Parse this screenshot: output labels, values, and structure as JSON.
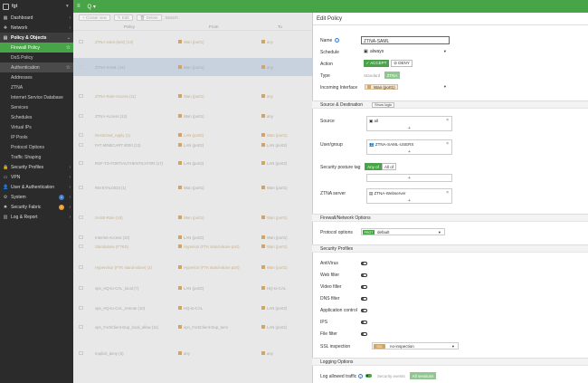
{
  "sidebar": {
    "device": "fgt",
    "items": [
      {
        "label": "Dashboard",
        "icon": "dashboard-icon",
        "glyph": "▦"
      },
      {
        "label": "Network",
        "icon": "network-icon",
        "glyph": "✚"
      },
      {
        "label": "Policy & Objects",
        "icon": "policy-icon",
        "glyph": "▤"
      }
    ],
    "sub": [
      "Firewall Policy",
      "DoS Policy",
      "Authentication",
      "Addresses",
      "ZTNA",
      "Internet Service Database",
      "Services",
      "Schedules",
      "Virtual IPs",
      "IP Pools",
      "Protocol Options",
      "Traffic Shaping"
    ],
    "bottom": [
      {
        "label": "Security Profiles",
        "icon": "security-profiles-icon",
        "glyph": "🔒"
      },
      {
        "label": "VPN",
        "icon": "vpn-icon",
        "glyph": "▭"
      },
      {
        "label": "User & Authentication",
        "icon": "user-icon",
        "glyph": "👤"
      },
      {
        "label": "System",
        "icon": "system-icon",
        "glyph": "⚙",
        "badge": "1"
      },
      {
        "label": "Security Fabric",
        "icon": "fabric-icon",
        "glyph": "✸",
        "badge": "1"
      },
      {
        "label": "Log & Report",
        "icon": "log-icon",
        "glyph": "▥"
      }
    ]
  },
  "topbar": {
    "menu": "≡",
    "search": "Q ▾"
  },
  "toolbar": {
    "create": "+ Create new",
    "edit": "✎ Edit",
    "search": "Search",
    "delete": "🗑 Delete"
  },
  "table": {
    "headers": [
      "Policy",
      "From",
      "To"
    ],
    "rows": [
      {
        "name": "ZTNA-rules-(test) (13)",
        "from": "Wan (port1)",
        "to": "any",
        "style": "tan"
      },
      {
        "name": "ZTNA-SAML (14)",
        "from": "Wan (port1)",
        "to": "any",
        "style": "sel"
      },
      {
        "name": "ZTNA-Rule-Access (11)",
        "from": "Wan (port1)",
        "to": "any",
        "style": "tan"
      },
      {
        "name": "ZTNA-Access (12)",
        "from": "Wan (port1)",
        "to": "any",
        "style": "normal"
      },
      {
        "name": "Restricted_Apply (1)",
        "from": "LAN (port2)",
        "to": "Wan (port1)",
        "style": "tan"
      },
      {
        "name": "FAT MINECART 8000 (13)",
        "from": "LAN (port2)",
        "to": "LAN (port2)",
        "style": "normal"
      },
      {
        "name": "RSF-TO-FORTIAUTHENTICATOR (17)",
        "from": "LAN (port2)",
        "to": "LAN (port2)",
        "style": "normal"
      },
      {
        "name": "RM ETAL0023 (1)",
        "from": "Wan (port1)",
        "to": "Wan (port1)",
        "style": "normal"
      },
      {
        "name": "SASE-Rule (18)",
        "from": "Wan (port1)",
        "to": "Wan (port1)",
        "style": "tan"
      },
      {
        "name": "Internet Access (10)",
        "from": "LAN (port2)",
        "to": "Wan (port1)",
        "style": "normal"
      },
      {
        "name": "Standalone (FTKD)",
        "from": "Hyperion (FTK stand-alone port)",
        "to": "Wan (port1)",
        "style": "tan"
      },
      {
        "name": "Hypervisor (FTK stand-alone) (3)",
        "from": "Hyperion (FTK stand-alone port)",
        "to": "Wan (port1)",
        "style": "tan"
      },
      {
        "name": "vpn_HQ-to-CAL_local (7)",
        "from": "LAN (port2)",
        "to": "HQ-to-CAL",
        "style": "normal"
      },
      {
        "name": "vpn_HQ-to-CAL_remote (10)",
        "from": "HQ-to-CAL",
        "to": "LAN (port2)",
        "style": "normal"
      },
      {
        "name": "vpn_FortiClient-Dup_local_allow (11)",
        "from": "vpn_FortiClient-Dup_tunn",
        "to": "LAN (port2)",
        "style": "normal"
      },
      {
        "name": "Implicit_deny (0)",
        "from": "any",
        "to": "any",
        "style": "normal"
      }
    ]
  },
  "panel": {
    "title": "Edit Policy",
    "name_label": "Name",
    "name_value": "ZTNA-SAML",
    "schedule_label": "Schedule",
    "schedule_value": "always",
    "action_label": "Action",
    "accept": "✓ ACCEPT",
    "deny": "⊘ DENY",
    "type_label": "Type",
    "type_standard": "Standard",
    "type_ztna": "ZTNA",
    "incoming_label": "Incoming Interface",
    "incoming_value": "Wan (port1)",
    "sect_source": "Source & Destination",
    "show_logic": "Show logic",
    "source_label": "Source",
    "source_value": "all",
    "usergroup_label": "User/group",
    "usergroup_value": "ZTNA-SAML-USERS",
    "posture_label": "Security posture tag",
    "any_of": "Any of",
    "all_of": "All of",
    "ztna_server_label": "ZTNA server",
    "ztna_server_value": "ZTNA-Webserver",
    "plus": "+",
    "sect_firewall": "Firewall/Network Options",
    "protocol_label": "Protocol options",
    "protocol_tag": "PROT",
    "protocol_value": "default",
    "sect_profiles": "Security Profiles",
    "profiles": [
      "AntiVirus",
      "Web filter",
      "Video filter",
      "DNS filter",
      "Application control",
      "IPS",
      "File filter"
    ],
    "ssl_label": "SSL inspection",
    "ssl_tag": "SSL",
    "ssl_value": "no-inspection",
    "sect_logging": "Logging Options",
    "log_label": "Log allowed traffic",
    "log_events": "Security events",
    "log_all": "All sessions"
  },
  "colors": {
    "brand": "#47a447",
    "sidebar": "#2b2b2b",
    "badge_blue": "#3a7bd5",
    "badge_orange": "#e89a2c"
  }
}
